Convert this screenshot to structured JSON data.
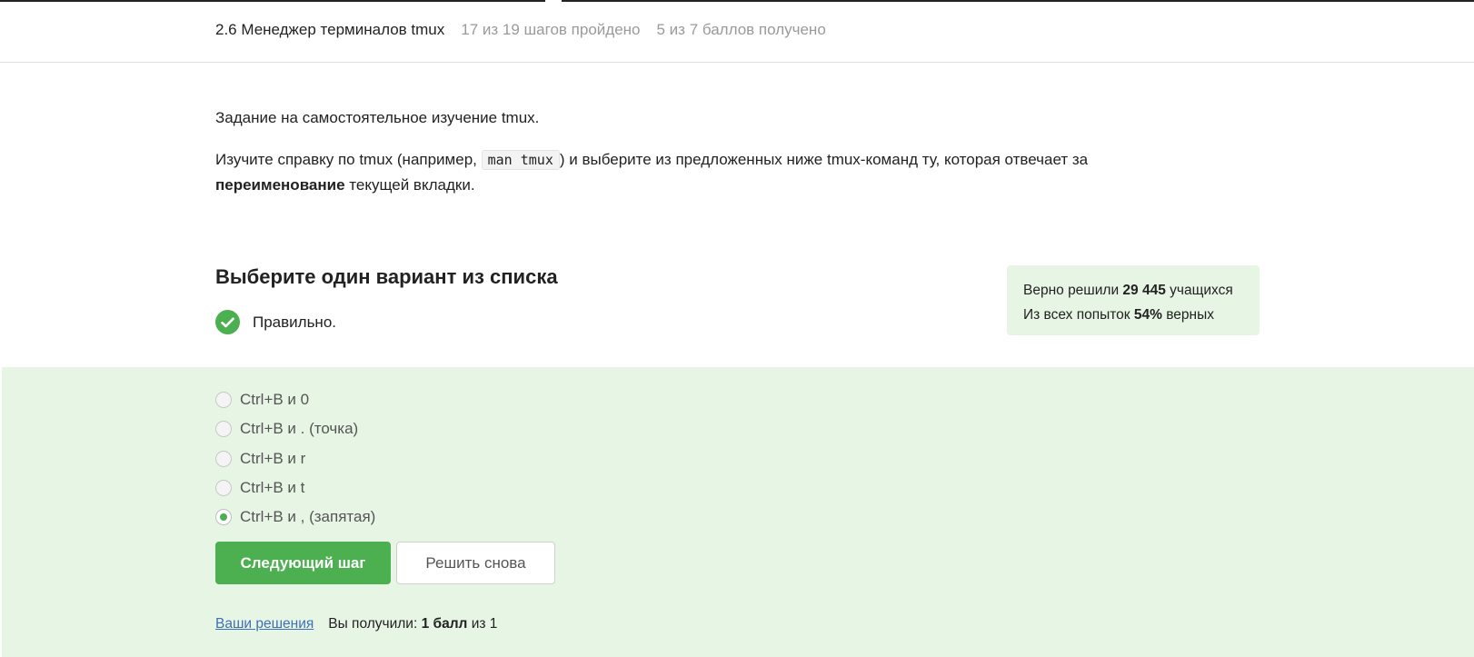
{
  "header": {
    "lesson_title": "2.6 Менеджер терминалов tmux",
    "steps_passed": "17 из 19 шагов пройдено",
    "points_got": "5 из 7 баллов  получено"
  },
  "task": {
    "intro": "Задание на самостоятельное изучение tmux.",
    "text_before_code": "Изучите справку по tmux (например, ",
    "code": "man tmux",
    "text_after_code": ") и выберите из предложенных ниже tmux-команд ту, которая отвечает за",
    "bold_word": "переименование",
    "text_end": " текущей вкладки."
  },
  "quiz": {
    "title": "Выберите один вариант из списка",
    "result": "Правильно.",
    "options": [
      {
        "label": "Ctrl+B и 0",
        "checked": false
      },
      {
        "label": "Ctrl+B и . (точка)",
        "checked": false
      },
      {
        "label": "Ctrl+B и r",
        "checked": false
      },
      {
        "label": "Ctrl+B и t",
        "checked": false
      },
      {
        "label": "Ctrl+B и , (запятая)",
        "checked": true
      }
    ]
  },
  "stats": {
    "solved_prefix": "Верно решили ",
    "solved_count": "29 445",
    "solved_suffix": " учащихся",
    "attempts_prefix": "Из всех попыток ",
    "attempts_percent": "54%",
    "attempts_suffix": " верных"
  },
  "buttons": {
    "next": "Следующий шаг",
    "retry": "Решить снова"
  },
  "footer": {
    "solutions_link": "Ваши решения",
    "score_prefix": "Вы получили: ",
    "score_value": "1 балл",
    "score_suffix": " из 1"
  },
  "colors": {
    "accent_green": "#4caf50",
    "answer_bg": "#e7f6e4",
    "link_blue": "#3f6fb5"
  }
}
